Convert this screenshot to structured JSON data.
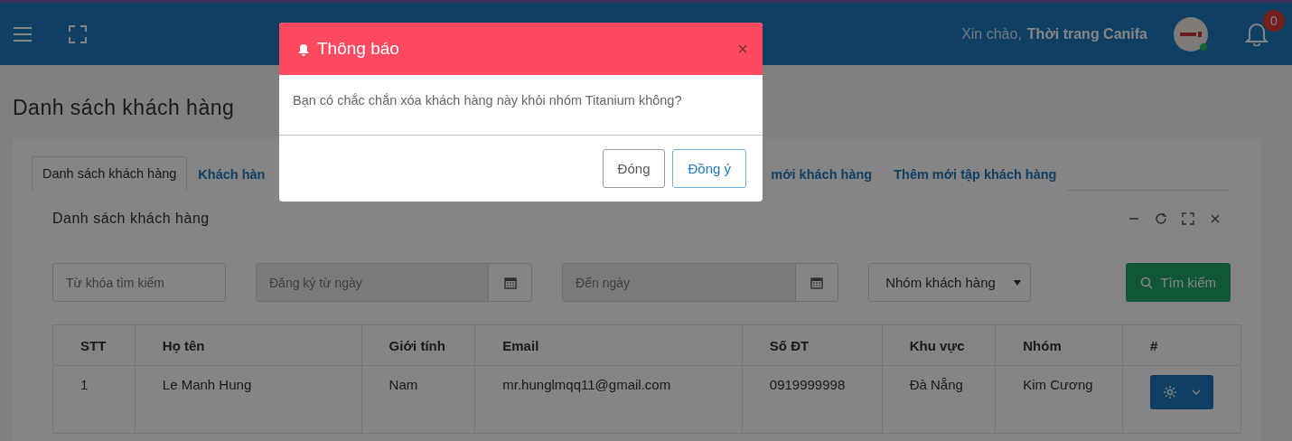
{
  "header": {
    "greeting": "Xin chào,",
    "user_name": "Thời trang Canifa",
    "notification_count": "0"
  },
  "page_title": "Danh sách khách hàng",
  "tabs": [
    {
      "label": "Danh sách khách hàng",
      "selected": true
    },
    {
      "label": "Khách hàn",
      "selected": false
    },
    {
      "label": "mới khách hàng",
      "selected": false
    },
    {
      "label": "Thêm mới tập khách hàng",
      "selected": false
    }
  ],
  "panel": {
    "title": "Danh sách khách hàng"
  },
  "filters": {
    "keyword_placeholder": "Từ khóa tìm kiếm",
    "from_date_placeholder": "Đăng ký từ ngày",
    "to_date_placeholder": "Đến ngày",
    "group_select": "Nhóm khách hàng",
    "search_button": "Tìm kiếm"
  },
  "table": {
    "columns": [
      "STT",
      "Họ tên",
      "Giới tính",
      "Email",
      "Số ĐT",
      "Khu vực",
      "Nhóm",
      "#"
    ],
    "rows": [
      {
        "cells": [
          "1",
          "Le Manh Hung",
          "Nam",
          "mr.hunglmqq11@gmail.com",
          "0919999998",
          "Đà Nẵng",
          "Kim Cương"
        ]
      }
    ]
  },
  "dialog": {
    "title": "Thông báo",
    "close": "×",
    "message": "Bạn có chắc chắn xóa khách hàng này khỏi nhóm Titanium không?",
    "buttons": [
      {
        "label": "Đóng",
        "kind": "default"
      },
      {
        "label": "Đồng ý",
        "kind": "primary"
      }
    ]
  }
}
